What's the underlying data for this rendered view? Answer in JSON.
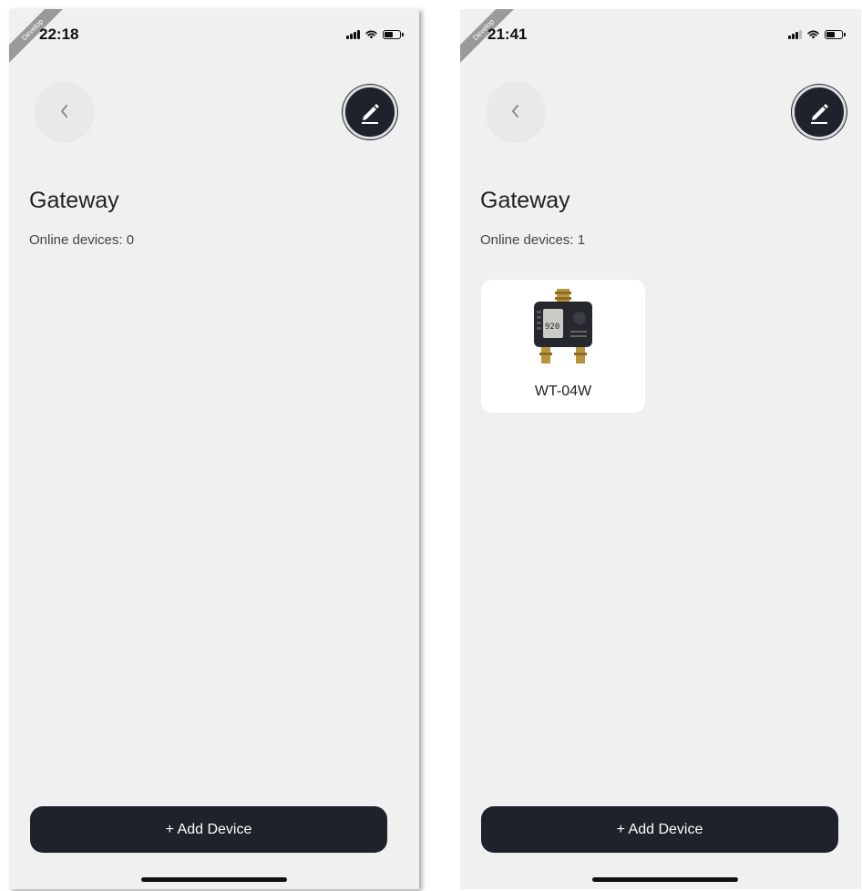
{
  "screens": [
    {
      "time": "22:18",
      "ribbon": "Develop",
      "title": "Gateway",
      "online_devices": "Online devices: 0",
      "add_device_label": "+ Add Device",
      "devices": []
    },
    {
      "time": "21:41",
      "ribbon": "Develop",
      "title": "Gateway",
      "online_devices": "Online devices: 1",
      "add_device_label": "+ Add Device",
      "devices": [
        {
          "name": "WT-04W",
          "lcd_text": "920"
        }
      ]
    }
  ],
  "icons": {
    "back": "chevron-left-icon",
    "edit": "pencil-icon",
    "signal": "cellular-signal-icon",
    "wifi": "wifi-icon",
    "battery": "battery-icon"
  },
  "colors": {
    "background": "#f0f0f0",
    "primary_dark": "#1d222b",
    "card": "#ffffff"
  }
}
